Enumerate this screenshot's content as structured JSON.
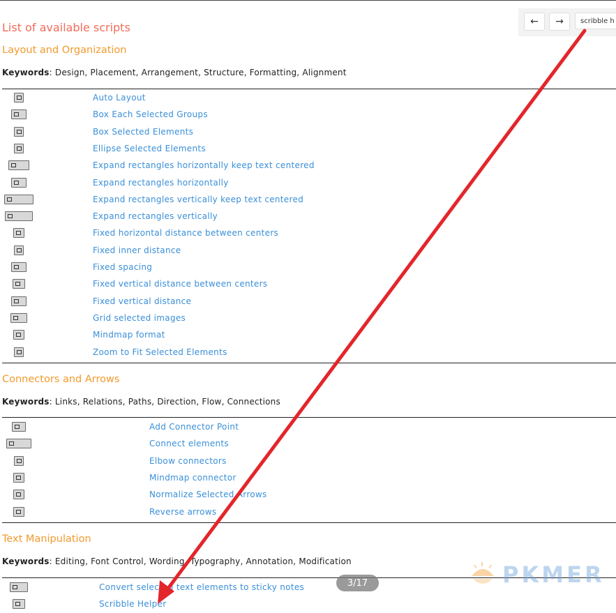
{
  "page_title": "List of available scripts",
  "nav": {
    "back": "←",
    "forward": "→",
    "search_value": "scribble h"
  },
  "sections": [
    {
      "title": "Layout and Organization",
      "keywords_label": "Keywords",
      "keywords": ": Design, Placement, Arrangement, Structure, Formatting, Alignment",
      "items": [
        {
          "label": "Auto Layout",
          "icon": "table-layout-icon"
        },
        {
          "label": "Box Each Selected Groups",
          "icon": "box-groups-icon"
        },
        {
          "label": "Box Selected Elements",
          "icon": "box-elements-icon"
        },
        {
          "label": "Ellipse Selected Elements",
          "icon": "ellipse-icon"
        },
        {
          "label": "Expand rectangles horizontally keep text centered",
          "icon": "expand-h-centered-icon"
        },
        {
          "label": "Expand rectangles horizontally",
          "icon": "expand-h-icon"
        },
        {
          "label": "Expand rectangles vertically keep text centered",
          "icon": "expand-v-centered-icon"
        },
        {
          "label": "Expand rectangles vertically",
          "icon": "expand-v-icon"
        },
        {
          "label": "Fixed horizontal distance between centers",
          "icon": "h-distance-icon"
        },
        {
          "label": "Fixed inner distance",
          "icon": "inner-distance-icon"
        },
        {
          "label": "Fixed spacing",
          "icon": "spacing-icon"
        },
        {
          "label": "Fixed vertical distance between centers",
          "icon": "v-distance-centers-icon"
        },
        {
          "label": "Fixed vertical distance",
          "icon": "v-distance-icon"
        },
        {
          "label": "Grid selected images",
          "icon": "grid-icon"
        },
        {
          "label": "Mindmap format",
          "icon": "mindmap-icon"
        },
        {
          "label": "Zoom to Fit Selected Elements",
          "icon": "zoom-icon"
        }
      ]
    },
    {
      "title": "Connectors and Arrows",
      "keywords_label": "Keywords",
      "keywords": ": Links, Relations, Paths, Direction, Flow, Connections",
      "items": [
        {
          "label": "Add Connector Point",
          "icon": "connector-point-icon"
        },
        {
          "label": "Connect elements",
          "icon": "connect-elements-icon"
        },
        {
          "label": "Elbow connectors",
          "icon": "elbow-icon"
        },
        {
          "label": "Mindmap connector",
          "icon": "mindmap-connector-icon"
        },
        {
          "label": "Normalize Selected Arrows",
          "icon": "normalize-arrows-icon"
        },
        {
          "label": "Reverse arrows",
          "icon": "reverse-arrows-icon"
        }
      ]
    },
    {
      "title": "Text Manipulation",
      "keywords_label": "Keywords",
      "keywords": ": Editing, Font Control, Wording, Typography, Annotation, Modification",
      "items": [
        {
          "label": "Convert selected text elements to sticky notes",
          "icon": "sticky-notes-icon"
        },
        {
          "label": "Scribble Helper",
          "icon": "scribble-icon"
        }
      ]
    }
  ],
  "pager": "3/17",
  "watermark": "PKMER",
  "colors": {
    "heading": "#f26c5a",
    "section": "#f29a2c",
    "link": "#3a8fd8",
    "arrow": "#e3262b"
  }
}
